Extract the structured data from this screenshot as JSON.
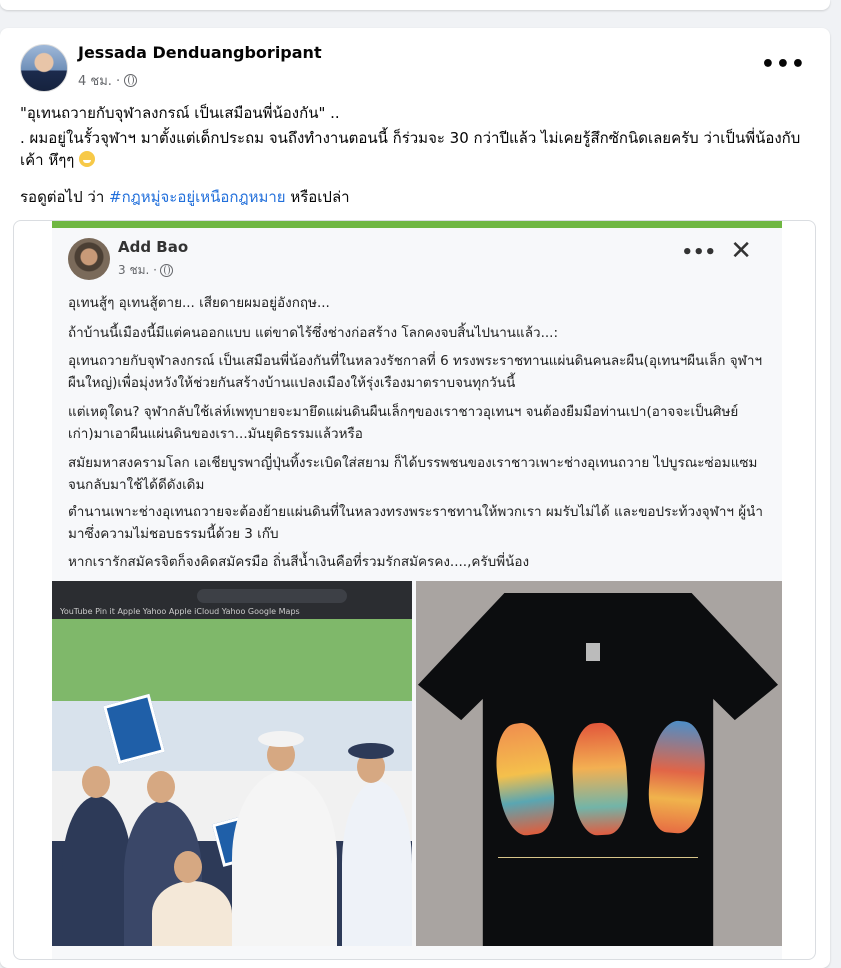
{
  "post": {
    "author": "Jessada Denduangboripant",
    "time": "4 ชม. ·",
    "line1": "\"อุเทนถวายกับจุฬาลงกรณ์ เป็นเสมือนพี่น้องกัน\" ..",
    "line2": ". ผมอยู่ในรั้วจุฬาฯ มาตั้งแต่เด็กประถม จนถึงทำงานตอนนี้ ก็ร่วมจะ 30 กว่าปีแล้ว ไม่เคยรู้สึกซักนิดเลยครับ ว่าเป็นพี่น้องกับเค้า หึๆๆ",
    "line3_prefix": "รอดูต่อไป ว่า ",
    "hashtag": "#กฎหมู่จะอยู่เหนือกฎหมาย",
    "line3_suffix": " หรือเปล่า"
  },
  "shared": {
    "author": "Add Bao",
    "time": "3 ชม. ·",
    "paragraphs": [
      "อุเทนสู้ๆ อุเทนสู้ตาย... เสียดายผมอยู่อังกฤษ...",
      "ถ้าบ้านนี้เมืองนี้มีแต่คนออกแบบ แต่ขาดไร้ซึ่งช่างก่อสร้าง โลกคงจบสิ้นไปนานแล้ว...:",
      "อุเทนถวายกับจุฬาลงกรณ์ เป็นเสมือนพี่น้องกันที่ในหลวงรัชกาลที่ 6 ทรงพระราชทานแผ่นดินคนละผืน(อุเทนฯผืนเล็ก จุฬาฯผืนใหญ่)เพื่อมุ่งหวังให้ช่วยกันสร้างบ้านแปลงเมืองให้รุ่งเรืองมาตราบจนทุกวันนี้",
      "แต่เหตุใดน? จุฬากลับใช้เล่ห์เพทุบายจะมายึดแผ่นดินผืนเล็กๆของเราชาวอุเทนฯ จนต้องยืมมือท่านเปา(อาจจะเป็นศิษย์เก่า)มาเอาผืนแผ่นดินของเรา...มันยุติธรรมแล้วหรือ",
      "สมัยมหาสงครามโลก เอเชียบูรพาญี่ปุ่นทิ้งระเบิดใส่สยาม ก็ได้บรรพชนของเราชาวเพาะช่างอุเทนถวาย ไปบูรณะซ่อมแซมจนกลับมาใช้ได้ดีดังเดิม",
      "ตำนานเพาะช่างอุเทนถวายจะต้องย้ายแผ่นดินที่ในหลวงทรงพระราชทานให้พวกเรา ผมรับไม่ได้ และขอประท้วงจุฬาฯ ผู้นำมาซึ่งความไม่ชอบธรรมนี้ด้วย 3 เก๊บ",
      "หากเรารักสมัครจิตก็จงคิดสมัครมือ ถิ่นสีน้ำเงินคือที่รวมรักสมัครคง....,ครับพี่น้อง"
    ],
    "browser_url": "ltnw1.topnews.co.th",
    "bookmarks": "YouTube  Pin it  Apple  Yahoo  Apple  iCloud  Yahoo  Google Maps"
  }
}
